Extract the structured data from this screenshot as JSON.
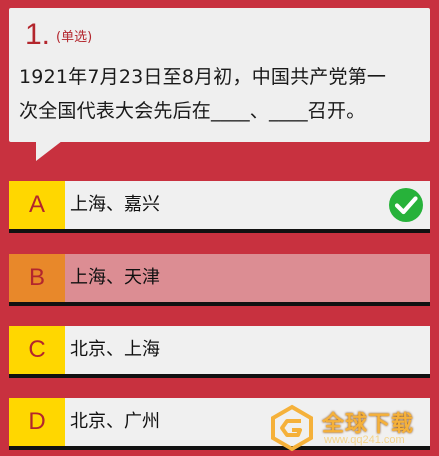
{
  "question": {
    "number": "1.",
    "type_label": "(单选)",
    "text_lines": [
      "1921年7月23日至8月初，中国共产党第一",
      "次全国代表大会先后在____、____召开。"
    ]
  },
  "options": [
    {
      "letter": "A",
      "text": "上海、嘉兴",
      "state": "correct",
      "icon": "check-circle-icon"
    },
    {
      "letter": "B",
      "text": "上海、天津",
      "state": "wrong"
    },
    {
      "letter": "C",
      "text": "北京、上海",
      "state": "normal"
    },
    {
      "letter": "D",
      "text": "北京、广州",
      "state": "normal"
    }
  ],
  "watermark": {
    "title": "全球下载",
    "url": "www.qq241.com"
  },
  "colors": {
    "background": "#c8313f",
    "letter_box": "#ffd700",
    "wrong_row": "#dc8d93",
    "wrong_letter_box": "#e8882a",
    "correct_check": "#27b23a"
  }
}
